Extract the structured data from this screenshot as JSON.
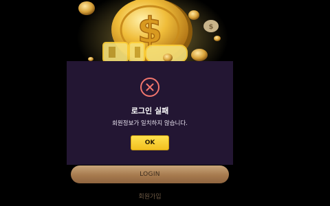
{
  "dialog": {
    "title": "로그인 실패",
    "message": "회원정보가 일치하지 않습니다.",
    "ok_label": "OK",
    "icon": "error-x-icon",
    "colors": {
      "background": "#231633",
      "icon": "#f2766e",
      "ok_button": "#f7cd2e"
    }
  },
  "form": {
    "login_label": "LOGIN",
    "signup_label": "회원가입"
  },
  "colors": {
    "page_background": "#000000",
    "login_button": "#b48a5e",
    "coin_gold": "#e8b23a"
  }
}
